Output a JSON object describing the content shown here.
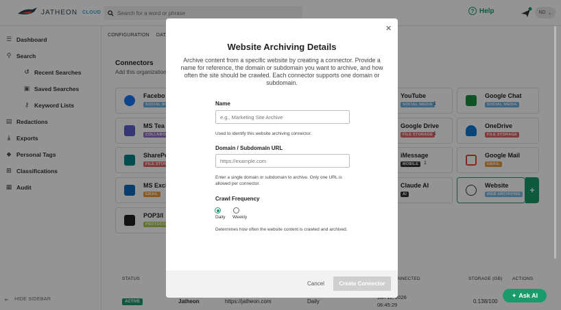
{
  "brand": {
    "name": "JATHEON",
    "suffix": "CLOUD"
  },
  "search": {
    "placeholder": "Search for a word or phrase"
  },
  "header": {
    "help": "Help",
    "avatar": "ND"
  },
  "sidebar": {
    "items": [
      {
        "label": "Dashboard",
        "icon": "dashboard-icon"
      },
      {
        "label": "Search",
        "icon": "search-icon"
      },
      {
        "label": "Recent Searches",
        "icon": "history-icon"
      },
      {
        "label": "Saved Searches",
        "icon": "save-icon"
      },
      {
        "label": "Keyword Lists",
        "icon": "key-icon"
      },
      {
        "label": "Redactions",
        "icon": "redact-icon"
      },
      {
        "label": "Exports",
        "icon": "export-icon"
      },
      {
        "label": "Personal Tags",
        "icon": "tag-icon"
      },
      {
        "label": "Classifications",
        "icon": "classification-icon"
      },
      {
        "label": "Audit",
        "icon": "audit-icon"
      }
    ],
    "hide": "HIDE SIDEBAR"
  },
  "tabs": [
    "CONFIGURATION",
    "DATA T"
  ],
  "connectors": {
    "title": "Connectors",
    "subtitle": "Add this organization",
    "cards": [
      {
        "title": "Facebo",
        "tag": "SOCIAL ME"
      },
      {
        "title": "MS Tea",
        "tag": "COLLABOR"
      },
      {
        "title": "SharePo",
        "tag": "FILE STORA"
      },
      {
        "title": "MS Exch",
        "tag": "EMAIL"
      },
      {
        "title": "POP3/I",
        "tag": "PROTOCO"
      },
      {
        "title": "YouTube",
        "tag": "SOCIAL MEDIA",
        "count": "1"
      },
      {
        "title": "Google Drive",
        "tag": "FILE STORAGE",
        "count": "1"
      },
      {
        "title": "iMessage",
        "tag": "MOBILE",
        "count": "1"
      },
      {
        "title": "Claude AI",
        "tag": "AI"
      },
      {
        "title": "Google Chat",
        "tag": "SOCIAL MEDIA"
      },
      {
        "title": "OneDrive",
        "tag": "FILE STORAGE"
      },
      {
        "title": "Google Mail",
        "tag": "EMAIL"
      },
      {
        "title": "Website",
        "tag": "WEB ARCHIVING"
      }
    ]
  },
  "table": {
    "headers": [
      "STATUS",
      "NNECTED",
      "STORAGE (GB)",
      "ACTIONS"
    ],
    "row": {
      "status": "ACTIVE",
      "name": "Jatheon",
      "url": "https://jatheon.com",
      "freq": "Daily",
      "date": "Jun 11, 2026",
      "time": "06:45:29",
      "storage": "0.138/100"
    }
  },
  "modal": {
    "title": "Website Archiving Details",
    "description": "Archive content from a specific website by creating a connector. Provide a name for reference, the domain or subdomain you want to archive, and how often the site should be crawled. Each connector supports one domain or subdomain.",
    "name_label": "Name",
    "name_placeholder": "e.g., Marketing Site Archive",
    "name_help": "Used to identify this website archiving connector.",
    "url_label": "Domain / Subdomain URL",
    "url_placeholder": "https://example.com",
    "url_help": "Enter a single domain or subdomain to archive. Only one URL is allowed per connector.",
    "freq_label": "Crawl Frequency",
    "freq_options": [
      "Daily",
      "Weekly"
    ],
    "freq_selected": "Daily",
    "freq_help": "Determines how often the website content is crawled and archived.",
    "cancel": "Cancel",
    "create": "Create Connector"
  },
  "askai": "Ask AI",
  "colors": {
    "accent": "#1a9b6c",
    "overlay": "rgba(0,0,0,0.42)"
  }
}
